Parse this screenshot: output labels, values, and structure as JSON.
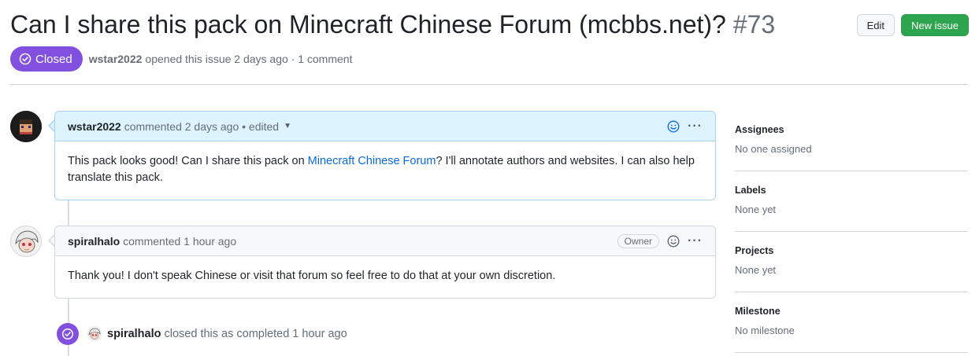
{
  "issue": {
    "title": "Can I share this pack on Minecraft Chinese Forum (mcbbs.net)?",
    "number": "#73",
    "state": "Closed",
    "author": "wstar2022",
    "meta_text": "opened this issue 2 days ago · 1 comment"
  },
  "actions": {
    "edit_label": "Edit",
    "new_issue_label": "New issue"
  },
  "comments": [
    {
      "author": "wstar2022",
      "meta": "commented 2 days ago • edited",
      "body_before": "This pack looks good! Can I share this pack on ",
      "body_link": "Minecraft Chinese Forum",
      "body_after": "? I'll annotate authors and websites. I can also help translate this pack."
    },
    {
      "author": "spiralhalo",
      "meta": "commented 1 hour ago",
      "badge": "Owner",
      "body": "Thank you! I don't speak Chinese or visit that forum so feel free to do that at your own discretion."
    }
  ],
  "event": {
    "author": "spiralhalo",
    "text": "closed this as completed 1 hour ago"
  },
  "sidebar": {
    "sections": [
      {
        "title": "Assignees",
        "value": "No one assigned"
      },
      {
        "title": "Labels",
        "value": "None yet"
      },
      {
        "title": "Projects",
        "value": "None yet"
      },
      {
        "title": "Milestone",
        "value": "No milestone"
      }
    ]
  },
  "colors": {
    "closed_purple": "#8250df",
    "new_issue_green": "#2da44e",
    "link_blue": "#0969da",
    "own_comment_header": "#ddf4ff"
  },
  "icons": [
    "check-circle-icon",
    "smiley-icon",
    "kebab-menu-icon",
    "caret-down-icon"
  ]
}
